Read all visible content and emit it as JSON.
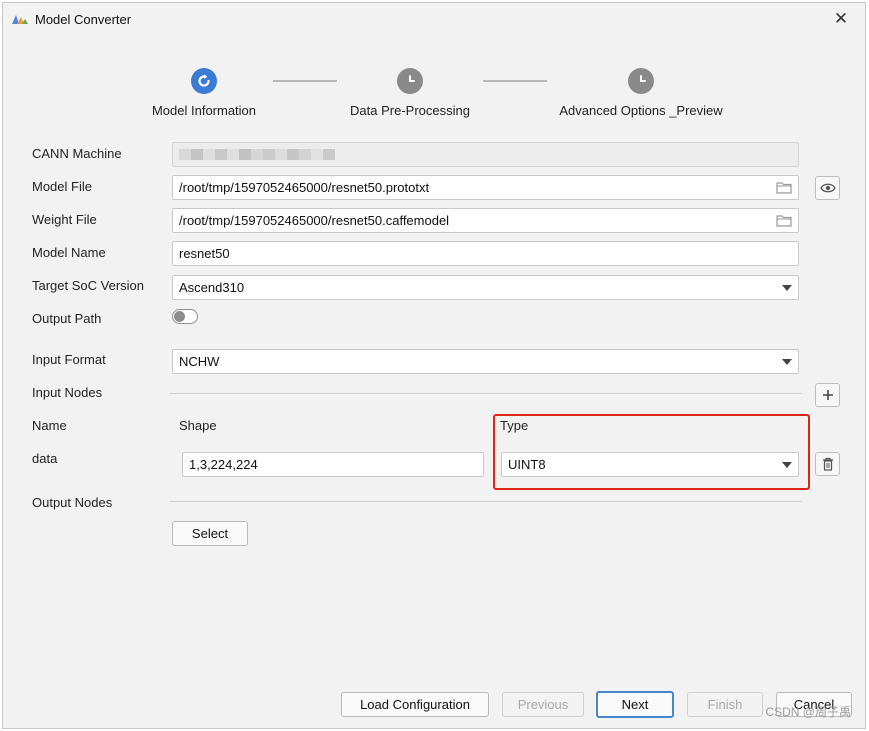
{
  "window": {
    "title": "Model Converter",
    "close_glyph": "✕"
  },
  "steps": [
    {
      "label": "Model Information",
      "state": "active"
    },
    {
      "label": "Data Pre-Processing",
      "state": "pending"
    },
    {
      "label": "Advanced Options _Preview",
      "state": "pending"
    }
  ],
  "form": {
    "cann_machine": {
      "label": "CANN Machine",
      "value": ""
    },
    "model_file": {
      "label": "Model File",
      "value": "/root/tmp/1597052465000/resnet50.prototxt"
    },
    "weight_file": {
      "label": "Weight File",
      "value": "/root/tmp/1597052465000/resnet50.caffemodel"
    },
    "model_name": {
      "label": "Model Name",
      "value": "resnet50"
    },
    "target_soc": {
      "label": "Target SoC Version",
      "value": "Ascend310"
    },
    "output_path": {
      "label": "Output Path",
      "enabled": false
    },
    "input_format": {
      "label": "Input Format",
      "value": "NCHW"
    },
    "input_nodes": {
      "label": "Input Nodes",
      "headers": {
        "name": "Name",
        "shape": "Shape",
        "type": "Type"
      },
      "rows": [
        {
          "name": "data",
          "shape": "1,3,224,224",
          "type": "UINT8"
        }
      ]
    },
    "output_nodes": {
      "label": "Output Nodes",
      "select_label": "Select"
    }
  },
  "footer": {
    "load_label": "Load Configuration",
    "previous_label": "Previous",
    "next_label": "Next",
    "finish_label": "Finish",
    "cancel_label": "Cancel"
  },
  "watermark": "CSDN @周子禹",
  "colors": {
    "accent": "#3a7bd5",
    "pending": "#8a8a8a",
    "highlight": "#e2231a"
  },
  "icons": [
    "app-logo-icon",
    "close-icon",
    "refresh-icon",
    "clock-icon",
    "folder-icon",
    "eye-icon",
    "chevron-down-icon",
    "plus-icon",
    "trash-icon"
  ]
}
